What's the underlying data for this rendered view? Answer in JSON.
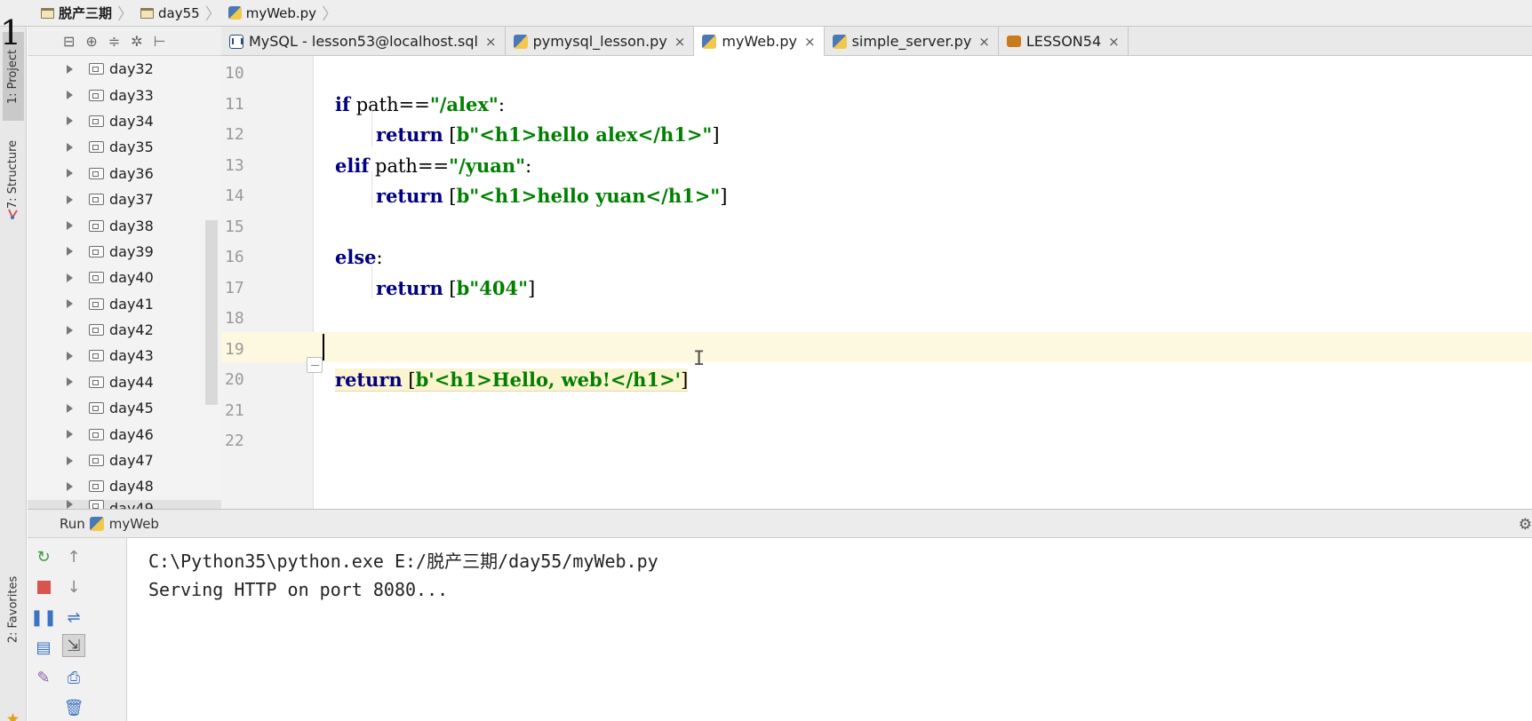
{
  "breadcrumb": {
    "items": [
      "脱产三期",
      "day55",
      "myWeb.py"
    ]
  },
  "left_strip": {
    "stray_char": "1",
    "tabs": [
      "1: Project",
      "7: Structure",
      "2: Favorites"
    ]
  },
  "project_toolbar": {
    "icons": [
      "layout-icon",
      "locate-icon",
      "collapse-icon",
      "settings-icon",
      "hide-icon"
    ]
  },
  "project_tree": {
    "items": [
      "day32",
      "day33",
      "day34",
      "day35",
      "day36",
      "day37",
      "day38",
      "day39",
      "day40",
      "day41",
      "day42",
      "day43",
      "day44",
      "day45",
      "day46",
      "day47",
      "day48"
    ],
    "partial_item": "day49"
  },
  "editor_tabs": [
    {
      "label": "MySQL - lesson53@localhost.sql",
      "icon": "sql-console-icon",
      "active": false
    },
    {
      "label": "pymysql_lesson.py",
      "icon": "python-file-icon",
      "active": false
    },
    {
      "label": "myWeb.py",
      "icon": "python-file-icon",
      "active": true
    },
    {
      "label": "simple_server.py",
      "icon": "python-file-icon",
      "active": false
    },
    {
      "label": "LESSON54",
      "icon": "sql-file-icon",
      "active": false
    }
  ],
  "tab_close_glyph": "×",
  "editor": {
    "current_line": 19,
    "lines": [
      {
        "num": "10"
      },
      {
        "num": "11",
        "kw": "if",
        "rest": " path==",
        "str": "\"/alex\"",
        "tail": ":"
      },
      {
        "num": "12",
        "kw": "return",
        "rest": " [",
        "str": "b\"<h1>hello alex</h1>\"",
        "tail": "]"
      },
      {
        "num": "13",
        "kw": "elif",
        "rest": " path==",
        "str": "\"/yuan\"",
        "tail": ":"
      },
      {
        "num": "14",
        "kw": "return",
        "rest": " [",
        "str": "b\"<h1>hello yuan</h1>\"",
        "tail": "]"
      },
      {
        "num": "15"
      },
      {
        "num": "16",
        "kw": "else",
        "rest": "",
        "str": "",
        "tail": ":"
      },
      {
        "num": "17",
        "kw": "return",
        "rest": " [",
        "str": "b\"404\"",
        "tail": "]"
      },
      {
        "num": "18"
      },
      {
        "num": "19"
      },
      {
        "num": "20",
        "kw": "return",
        "rest": " [",
        "str": "b'<h1>Hello, web!</h1>'",
        "tail": "]"
      },
      {
        "num": "21"
      },
      {
        "num": "22"
      }
    ]
  },
  "run_panel": {
    "label": "Run",
    "config": "myWeb",
    "output": [
      "C:\\Python35\\python.exe E:/脱产三期/day55/myWeb.py",
      "Serving HTTP on port 8080..."
    ]
  },
  "colors": {
    "keyword": "#000080",
    "string": "#008000",
    "current_line": "#fdf8e0",
    "rerun_green": "#3b9a3b",
    "stop_red": "#d9534f",
    "pause_blue": "#3b73c2"
  }
}
